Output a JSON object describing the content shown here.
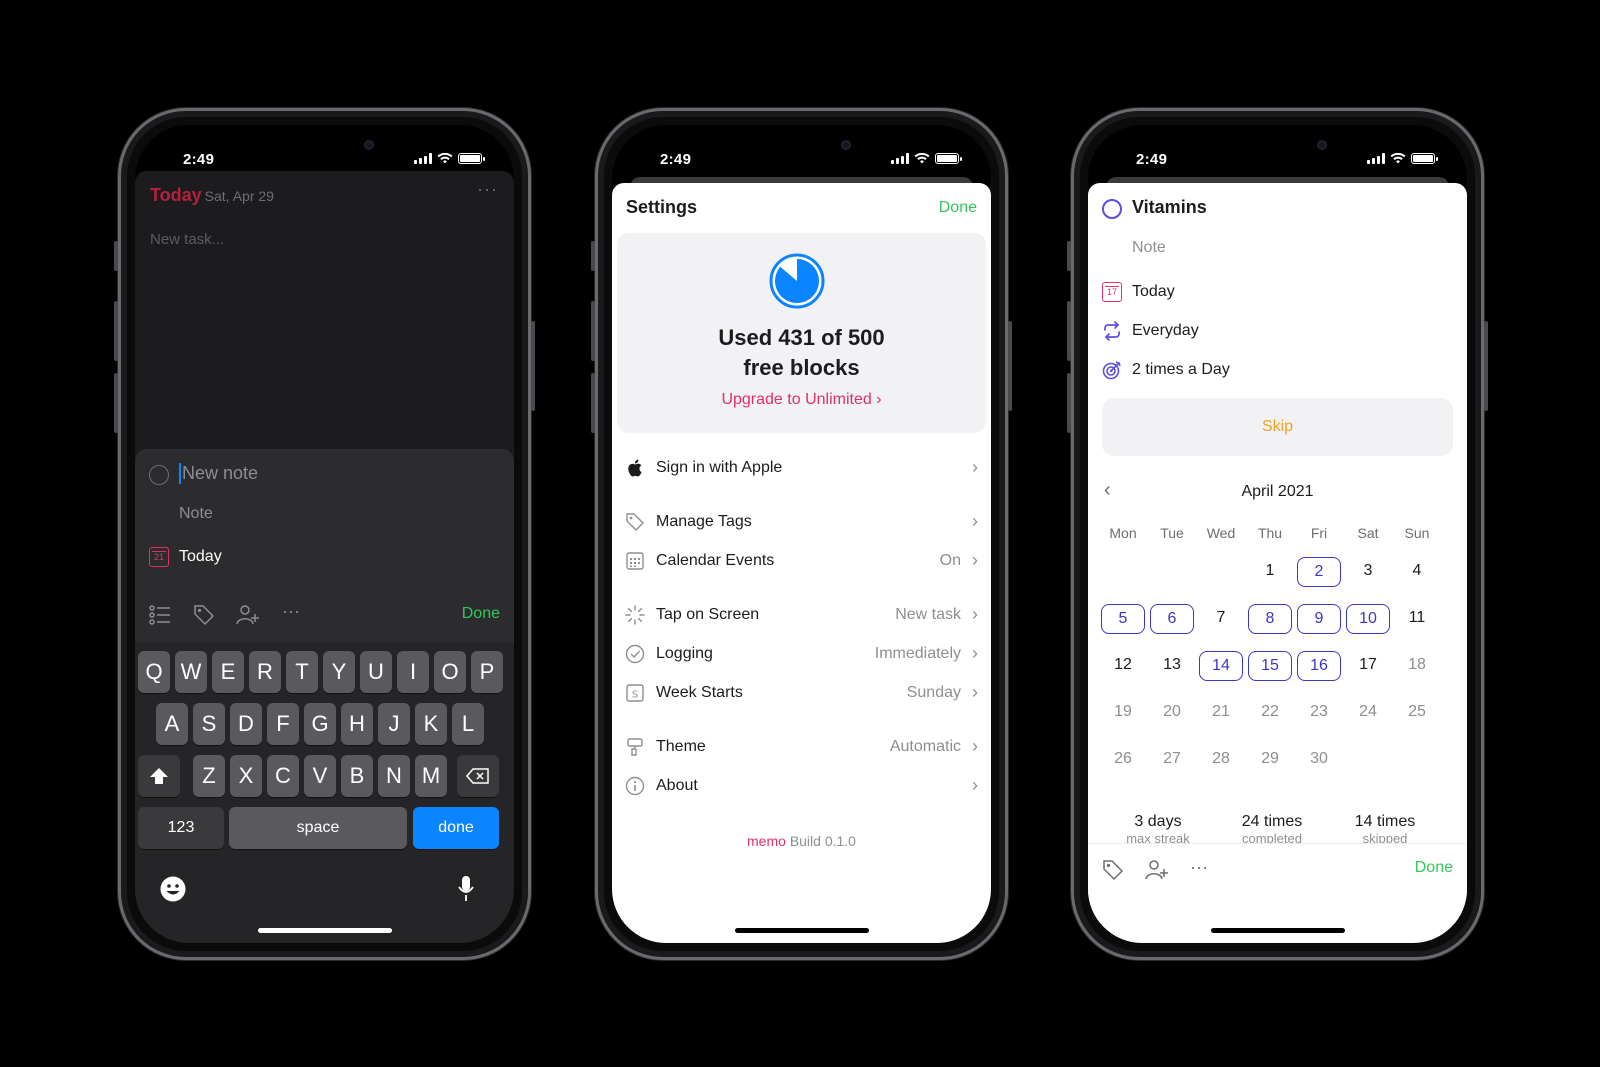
{
  "status": {
    "time": "2:49"
  },
  "phone1": {
    "today": "Today",
    "date": "Sat, Apr 29",
    "more": "···",
    "new_task_placeholder": "New task...",
    "new_note": "New note",
    "note": "Note",
    "today_row": "Today",
    "calendar_day": "21",
    "done": "Done",
    "keys_row1": [
      "Q",
      "W",
      "E",
      "R",
      "T",
      "Y",
      "U",
      "I",
      "O",
      "P"
    ],
    "keys_row2": [
      "A",
      "S",
      "D",
      "F",
      "G",
      "H",
      "J",
      "K",
      "L"
    ],
    "keys_row3": [
      "Z",
      "X",
      "C",
      "V",
      "B",
      "N",
      "M"
    ],
    "key_123": "123",
    "key_space": "space",
    "key_done": "done"
  },
  "phone2": {
    "title": "Settings",
    "done": "Done",
    "usage_line1": "Used 431 of 500",
    "usage_line2": "free blocks",
    "upgrade": "Upgrade to Unlimited",
    "used_blocks": 431,
    "total_blocks": 500,
    "rows": [
      {
        "label": "Sign in with Apple",
        "value": ""
      },
      {
        "label": "Manage Tags",
        "value": ""
      },
      {
        "label": "Calendar Events",
        "value": "On"
      },
      {
        "label": "Tap on Screen",
        "value": "New task"
      },
      {
        "label": "Logging",
        "value": "Immediately"
      },
      {
        "label": "Week Starts",
        "value": "Sunday"
      },
      {
        "label": "Theme",
        "value": "Automatic"
      },
      {
        "label": "About",
        "value": ""
      }
    ],
    "build_app": "memo",
    "build_version": "Build 0.1.0"
  },
  "phone3": {
    "title": "Vitamins",
    "note": "Note",
    "date": "Today",
    "calendar_day": "17",
    "repeat": "Everyday",
    "goal": "2 times a Day",
    "skip": "Skip",
    "month": "April 2021",
    "weekdays": [
      "Mon",
      "Tue",
      "Wed",
      "Thu",
      "Fri",
      "Sat",
      "Sun"
    ],
    "days": [
      "1",
      "2",
      "3",
      "4",
      "5",
      "6",
      "7",
      "8",
      "9",
      "10",
      "11",
      "12",
      "13",
      "14",
      "15",
      "16",
      "17",
      "18",
      "19",
      "20",
      "21",
      "22",
      "23",
      "24",
      "25",
      "26",
      "27",
      "28",
      "29",
      "30"
    ],
    "marked_days": [
      2,
      5,
      6,
      8,
      9,
      10,
      14,
      15,
      16
    ],
    "stats": [
      {
        "value": "3 days",
        "label": "max streak"
      },
      {
        "value": "24 times",
        "label": "completed"
      },
      {
        "value": "14 times",
        "label": "skipped"
      }
    ],
    "done": "Done"
  },
  "colors": {
    "accent_green": "#34c759",
    "accent_pink": "#e0306a",
    "accent_blue": "#0a84ff",
    "accent_purple": "#3b36c8",
    "skip_orange": "#f0a020"
  }
}
